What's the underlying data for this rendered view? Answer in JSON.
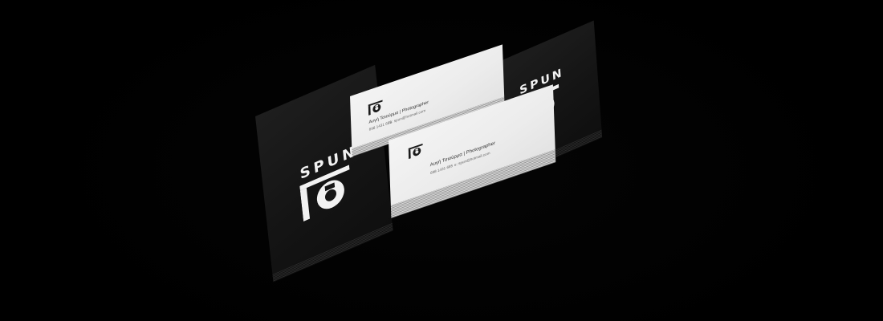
{
  "brand": {
    "wordmark": "SPUN",
    "logo_icon": "camera-lens-icon"
  },
  "business_card": {
    "name_line": "Αυγή Τσιούρμα | Photographer",
    "phone": "698 1431 685",
    "email": "e: spun@hotmail.com"
  },
  "colors": {
    "background": "#000000",
    "black_card": "#161616",
    "white_card": "#ededed",
    "logo_light": "#f2f2f2",
    "logo_dark": "#1a1a1a"
  }
}
